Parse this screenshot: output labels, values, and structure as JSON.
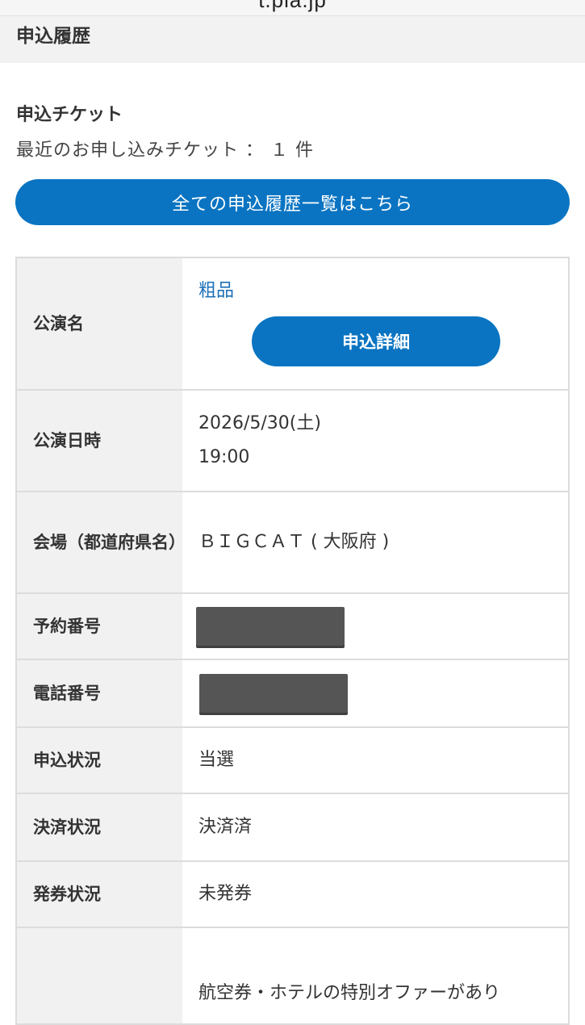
{
  "browser": {
    "url": "t.pia.jp"
  },
  "header": {
    "title": "申込履歴"
  },
  "tickets": {
    "section_title": "申込チケット",
    "recent_count": "最近のお申し込みチケット ： １ 件",
    "all_history_button": "全ての申込履歴一覧はこちら"
  },
  "details": {
    "event_name_label": "公演名",
    "event_name": "粗品",
    "detail_button": "申込詳細",
    "date_label": "公演日時",
    "date_line1": "2026/5/30(土)",
    "date_line2": "19:00",
    "venue_label": "会場（都道府県名）",
    "venue": "ＢＩＧＣＡＴ ( 大阪府 )",
    "reservation_label": "予約番号",
    "phone_label": "電話番号",
    "status_label": "申込状況",
    "status": "当選",
    "payment_label": "決済状況",
    "payment": "決済済",
    "issue_label": "発券状況",
    "issue": "未発券",
    "offer_text": "航空券・ホテルの特別オファーがあり"
  },
  "colors": {
    "accent_blue": "#0a74c2",
    "link_blue": "#1d6fb8",
    "status_pink": "#e65b9a"
  }
}
